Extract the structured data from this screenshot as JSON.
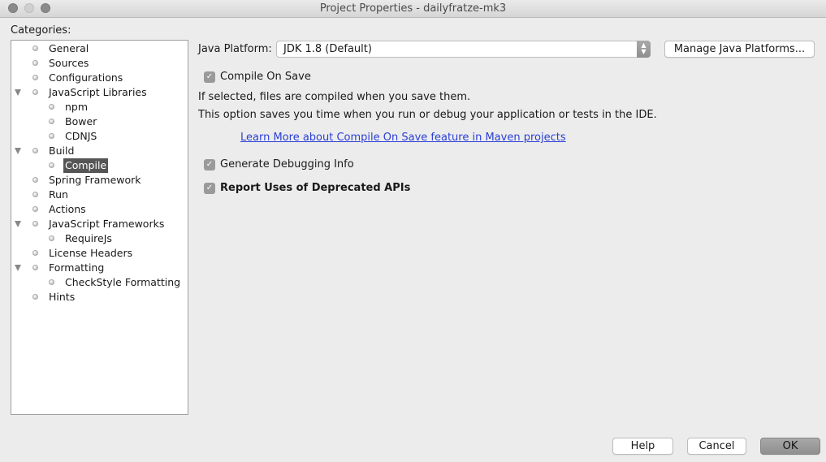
{
  "window": {
    "title": "Project Properties - dailyfratze-mk3"
  },
  "categories": {
    "label": "Categories:",
    "items": [
      {
        "label": "General",
        "level": 0,
        "expandable": false,
        "selected": false
      },
      {
        "label": "Sources",
        "level": 0,
        "expandable": false,
        "selected": false
      },
      {
        "label": "Configurations",
        "level": 0,
        "expandable": false,
        "selected": false
      },
      {
        "label": "JavaScript Libraries",
        "level": 0,
        "expandable": true,
        "selected": false
      },
      {
        "label": "npm",
        "level": 1,
        "expandable": false,
        "selected": false
      },
      {
        "label": "Bower",
        "level": 1,
        "expandable": false,
        "selected": false
      },
      {
        "label": "CDNJS",
        "level": 1,
        "expandable": false,
        "selected": false
      },
      {
        "label": "Build",
        "level": 0,
        "expandable": true,
        "selected": false
      },
      {
        "label": "Compile",
        "level": 1,
        "expandable": false,
        "selected": true
      },
      {
        "label": "Spring Framework",
        "level": 0,
        "expandable": false,
        "selected": false
      },
      {
        "label": "Run",
        "level": 0,
        "expandable": false,
        "selected": false
      },
      {
        "label": "Actions",
        "level": 0,
        "expandable": false,
        "selected": false
      },
      {
        "label": "JavaScript Frameworks",
        "level": 0,
        "expandable": true,
        "selected": false
      },
      {
        "label": "RequireJs",
        "level": 1,
        "expandable": false,
        "selected": false
      },
      {
        "label": "License Headers",
        "level": 0,
        "expandable": false,
        "selected": false
      },
      {
        "label": "Formatting",
        "level": 0,
        "expandable": true,
        "selected": false
      },
      {
        "label": "CheckStyle Formatting",
        "level": 1,
        "expandable": false,
        "selected": false
      },
      {
        "label": "Hints",
        "level": 0,
        "expandable": false,
        "selected": false
      }
    ]
  },
  "compile": {
    "java_platform_label": "Java Platform:",
    "java_platform_value": "JDK 1.8 (Default)",
    "manage_platforms_button": "Manage Java Platforms...",
    "compile_on_save": {
      "label": "Compile On Save",
      "checked": true
    },
    "description_line1": "If selected, files are compiled when you save them.",
    "description_line2": "This option saves you time when you run or debug your application or tests in the IDE.",
    "learn_more_link": "Learn More about Compile On Save feature in Maven projects",
    "generate_debugging_info": {
      "label": "Generate Debugging Info",
      "checked": true
    },
    "report_deprecated": {
      "label": "Report Uses of Deprecated APIs",
      "checked": true
    }
  },
  "footer": {
    "help": "Help",
    "cancel": "Cancel",
    "ok": "OK"
  },
  "icons": {
    "checkmark": "✓",
    "combo_arrows": "⌃⌄"
  }
}
